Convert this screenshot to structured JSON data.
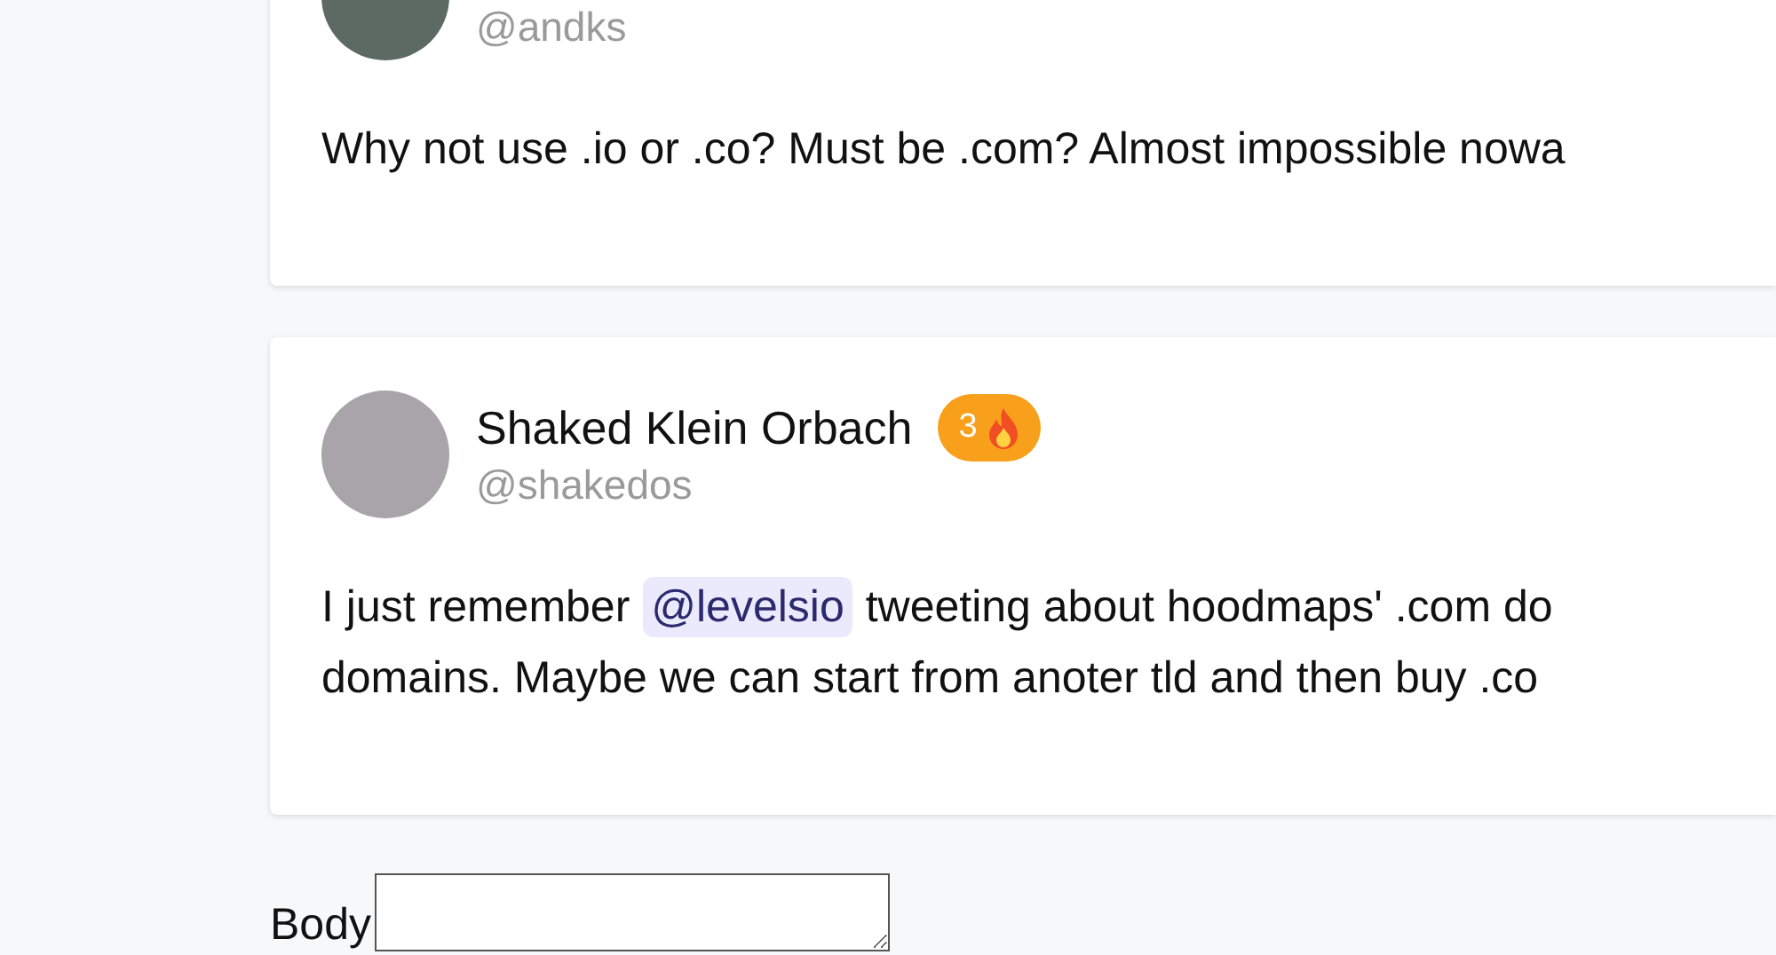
{
  "comments": [
    {
      "handle": "@andks",
      "lines": [
        [
          {
            "kind": "text",
            "text": "Why not use .io or .co? Must be .com? Almost impossible nowa"
          }
        ]
      ]
    },
    {
      "name": "Shaked Klein Orbach",
      "handle": "@shakedos",
      "badge": "3",
      "lines": [
        [
          {
            "kind": "text",
            "text": "I just remember "
          },
          {
            "kind": "mention",
            "text": "@levelsio"
          },
          {
            "kind": "text",
            "text": " tweeting about hoodmaps' .com do"
          }
        ],
        [
          {
            "kind": "text",
            "text": "domains. Maybe we can start from anoter tld and then buy .co"
          }
        ]
      ]
    }
  ],
  "form": {
    "body_label": "Body"
  }
}
